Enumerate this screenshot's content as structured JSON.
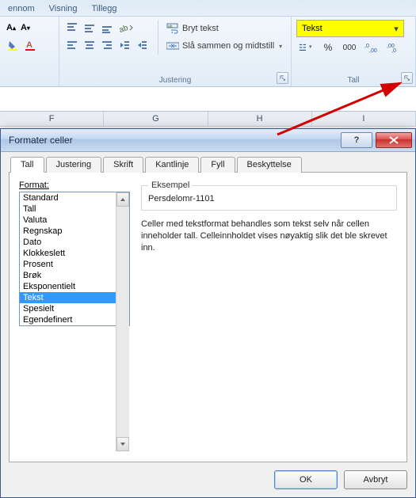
{
  "ribbon": {
    "tabs": [
      "ennom",
      "Visning",
      "Tillegg"
    ],
    "alignment": {
      "group_label": "Justering",
      "wrap_text": "Bryt tekst",
      "merge_center": "Slå sammen og midtstill"
    },
    "number": {
      "group_label": "Tall",
      "format_selected": "Tekst",
      "percent": "%",
      "thousand": "000"
    }
  },
  "columns": [
    "F",
    "G",
    "H",
    "I"
  ],
  "dialog": {
    "title": "Formater celler",
    "tabs": {
      "tall": "Tall",
      "justering": "Justering",
      "skrift": "Skrift",
      "kantlinje": "Kantlinje",
      "fyll": "Fyll",
      "beskyttelse": "Beskyttelse"
    },
    "format_label": "Format:",
    "format_list": [
      "Standard",
      "Tall",
      "Valuta",
      "Regnskap",
      "Dato",
      "Klokkeslett",
      "Prosent",
      "Brøk",
      "Eksponentielt",
      "Tekst",
      "Spesielt",
      "Egendefinert"
    ],
    "format_selected": "Tekst",
    "sample_label": "Eksempel",
    "sample_value": "Persdelomr-1101",
    "description": "Celler med tekstformat behandles som tekst selv når cellen inneholder tall. Celleinnholdet vises nøyaktig slik det ble skrevet inn.",
    "ok": "OK",
    "cancel": "Avbryt",
    "help": "?"
  }
}
